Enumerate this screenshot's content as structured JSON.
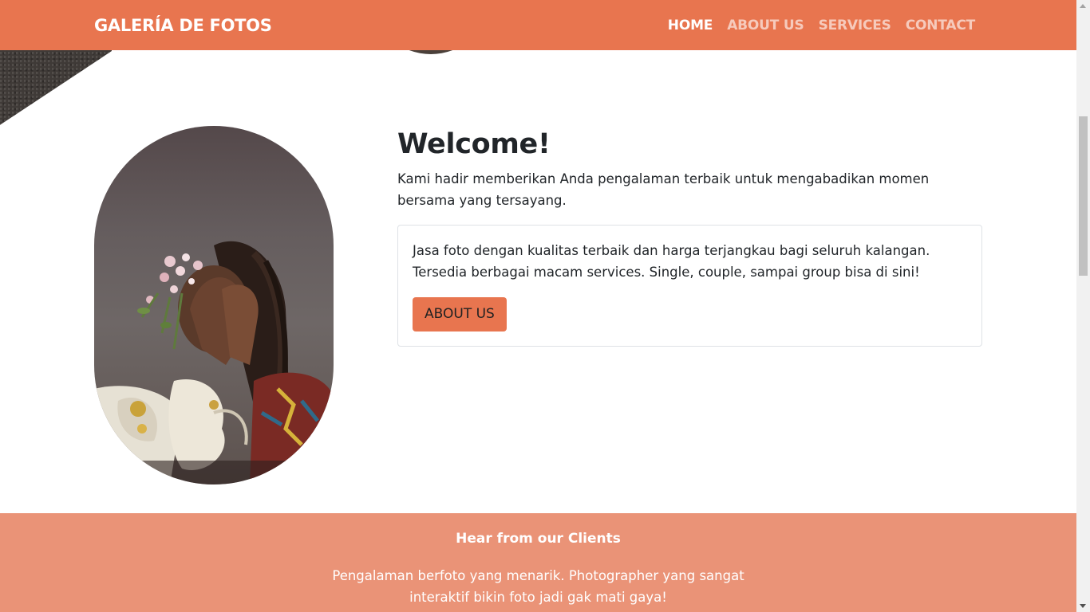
{
  "navbar": {
    "brand": "GALERÍA DE FOTOS",
    "links": [
      {
        "label": "HOME",
        "active": true
      },
      {
        "label": "ABOUT US",
        "active": false
      },
      {
        "label": "SERVICES",
        "active": false
      },
      {
        "label": "CONTACT",
        "active": false
      }
    ]
  },
  "hero": {
    "title": "Welcome!",
    "lead": "Kami hadir memberikan Anda pengalaman terbaik untuk mengabadikan momen bersama yang tersayang.",
    "card_text": "Jasa foto dengan kualitas terbaik dan harga terjangkau bagi seluruh kalangan. Tersedia berbagai macam services. Single, couple, sampai group bisa di sini!",
    "button_label": "ABOUT US"
  },
  "clients": {
    "heading": "Hear from our Clients",
    "quote": "Pengalaman berfoto yang menarik. Photographer yang sangat interaktif bikin foto jadi gak mati gaya!"
  },
  "colors": {
    "primary": "#e8754f",
    "clients_bg": "#ea9377",
    "text": "#212529"
  },
  "icons": {
    "scroll_up": "triangle-up",
    "scroll_down": "triangle-down"
  }
}
